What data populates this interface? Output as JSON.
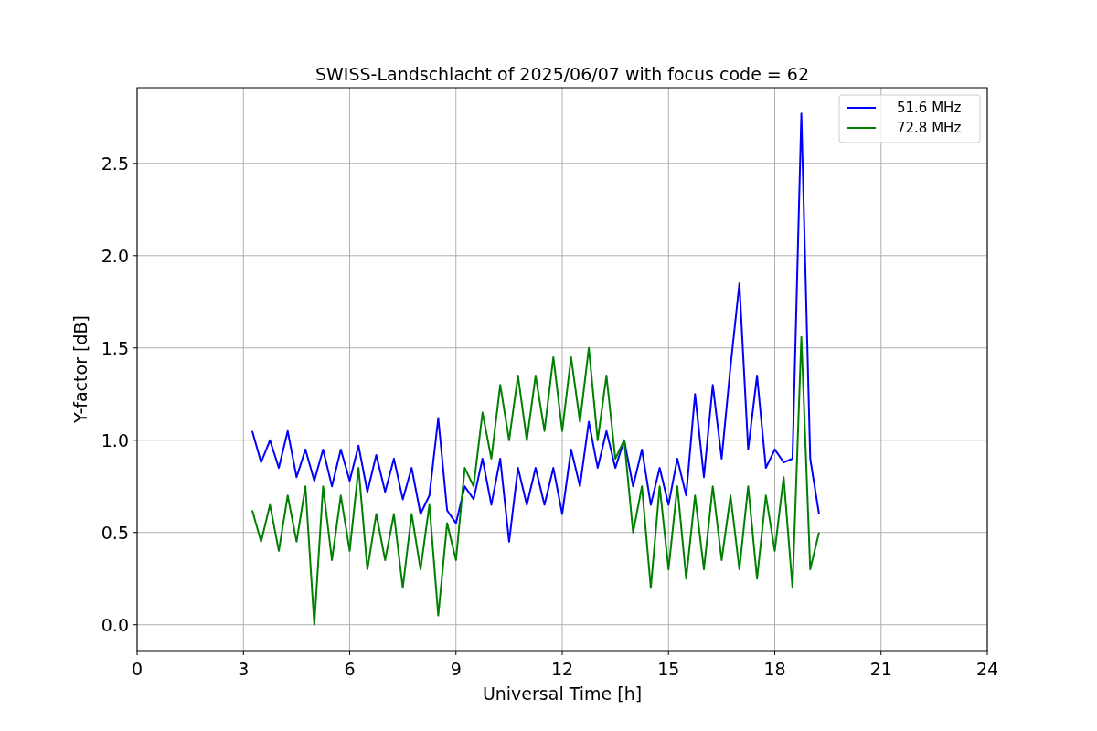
{
  "chart_data": {
    "type": "line",
    "title": "SWISS-Landschlacht of 2025/06/07 with focus code = 62",
    "xlabel": "Universal Time [h]",
    "ylabel": "Y-factor [dB]",
    "x": [
      3.25,
      3.5,
      3.75,
      4.0,
      4.25,
      4.5,
      4.75,
      5.0,
      5.25,
      5.5,
      5.75,
      6.0,
      6.25,
      6.5,
      6.75,
      7.0,
      7.25,
      7.5,
      7.75,
      8.0,
      8.25,
      8.5,
      8.75,
      9.0,
      9.25,
      9.5,
      9.75,
      10.0,
      10.25,
      10.5,
      10.75,
      11.0,
      11.25,
      11.5,
      11.75,
      12.0,
      12.25,
      12.5,
      12.75,
      13.0,
      13.25,
      13.5,
      13.75,
      14.0,
      14.25,
      14.5,
      14.75,
      15.0,
      15.25,
      15.5,
      15.75,
      16.0,
      16.25,
      16.5,
      16.75,
      17.0,
      17.25,
      17.5,
      17.75,
      18.0,
      18.25,
      18.5,
      18.75,
      19.0,
      19.25
    ],
    "series": [
      {
        "name": "51.6 MHz",
        "color": "#0000ff",
        "values": [
          1.05,
          0.88,
          1.0,
          0.85,
          1.05,
          0.8,
          0.95,
          0.78,
          0.95,
          0.75,
          0.95,
          0.78,
          0.97,
          0.72,
          0.92,
          0.72,
          0.9,
          0.68,
          0.85,
          0.6,
          0.7,
          1.12,
          0.62,
          0.55,
          0.75,
          0.68,
          0.9,
          0.65,
          0.9,
          0.45,
          0.85,
          0.65,
          0.85,
          0.65,
          0.85,
          0.6,
          0.95,
          0.75,
          1.1,
          0.85,
          1.05,
          0.85,
          1.0,
          0.75,
          0.95,
          0.65,
          0.85,
          0.65,
          0.9,
          0.7,
          1.25,
          0.8,
          1.3,
          0.9,
          1.4,
          1.85,
          0.95,
          1.35,
          0.85,
          0.95,
          0.88,
          0.9,
          2.77,
          0.9,
          0.6
        ]
      },
      {
        "name": "72.8 MHz",
        "color": "#008000",
        "values": [
          0.62,
          0.45,
          0.65,
          0.4,
          0.7,
          0.45,
          0.75,
          0.0,
          0.75,
          0.35,
          0.7,
          0.4,
          0.85,
          0.3,
          0.6,
          0.35,
          0.6,
          0.2,
          0.6,
          0.3,
          0.65,
          0.05,
          0.55,
          0.35,
          0.85,
          0.75,
          1.15,
          0.9,
          1.3,
          1.0,
          1.35,
          1.0,
          1.35,
          1.05,
          1.45,
          1.05,
          1.45,
          1.1,
          1.5,
          1.0,
          1.35,
          0.9,
          1.0,
          0.5,
          0.75,
          0.2,
          0.75,
          0.3,
          0.75,
          0.25,
          0.7,
          0.3,
          0.75,
          0.35,
          0.7,
          0.3,
          0.75,
          0.25,
          0.7,
          0.4,
          0.8,
          0.2,
          1.56,
          0.3,
          0.5
        ]
      }
    ],
    "grid": true,
    "legend": "upper right",
    "xlim": [
      0,
      24
    ],
    "ylim": [
      -0.14,
      2.91
    ],
    "xticks": [
      0,
      3,
      6,
      9,
      12,
      15,
      18,
      21,
      24
    ],
    "yticks": [
      {
        "value": 0,
        "label": "0.0"
      },
      {
        "value": 0.5,
        "label": "0.5"
      },
      {
        "value": 1,
        "label": "1.0"
      },
      {
        "value": 1.5,
        "label": "1.5"
      },
      {
        "value": 2,
        "label": "2.0"
      },
      {
        "value": 2.5,
        "label": "2.5"
      }
    ]
  }
}
